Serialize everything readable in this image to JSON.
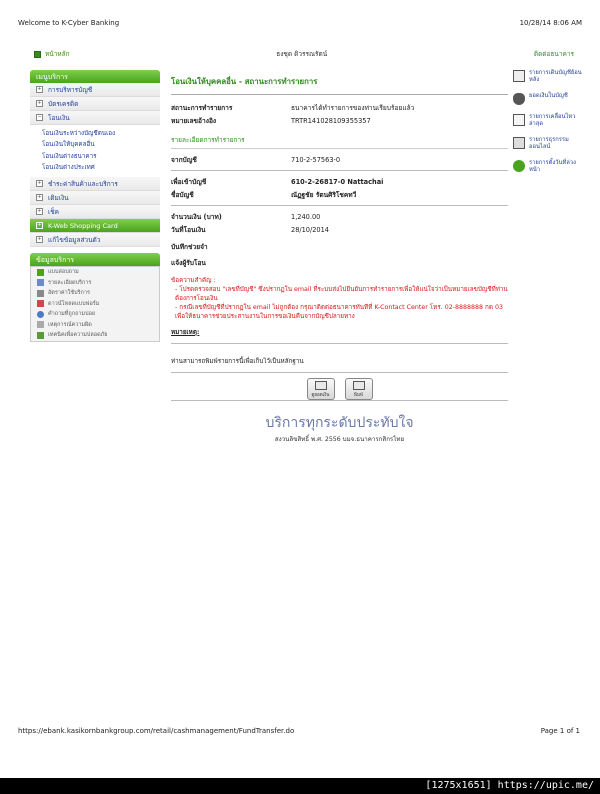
{
  "print_header": {
    "title": "Welcome to K-Cyber Banking",
    "datetime": "10/28/14 8:06 AM"
  },
  "topbar": {
    "home": "หน้าหลัก",
    "user": "ธงชุด ดิวรรณรัตน์",
    "contact": "ติดต่อธนาคาร"
  },
  "sidebar": {
    "menu_title": "เมนูบริการ",
    "items_top": [
      "การบริหารบัญชี",
      "บัตรเครดิต"
    ],
    "transfer_label": "โอนเงิน",
    "transfer_sub": [
      "โอนเงินระหว่างบัญชีตนเอง",
      "โอนเงินให้บุคคลอื่น",
      "โอนเงินต่างธนาคาร",
      "โอนเงินต่างประเทศ"
    ],
    "items_bottom": [
      "ชำระค่าสินค้าและบริการ",
      "เติมเงิน",
      "เช็ค"
    ],
    "kweb": "K-Web Shopping Card",
    "edit_info": "แก้ไขข้อมูลส่วนตัว",
    "info_title": "ข้อมูลบริการ",
    "info_items": [
      "แบบสอบถาม",
      "รายละเอียดบริการ",
      "อัตราค่าใช้บริการ",
      "ดาวน์โหลดแบบฟอร์ม",
      "คำถามที่ถูกถามบ่อย",
      "เหตุการณ์ความผิด",
      "เทคนิคเพื่อความปลอดภัย"
    ]
  },
  "main": {
    "title": "โอนเงินให้บุคคลอื่น - สถานะการทำรายการ",
    "status_label": "สถานะการทำรายการ",
    "status_value": "ธนาคารได้ทำรายการของท่านเรียบร้อยแล้ว",
    "ref_label": "หมายเลขอ้างอิง",
    "ref_value": "TRTR141028109355357",
    "section_title": "รายละเอียดการทำรายการ",
    "from_label": "จากบัญชี",
    "from_value": "710-2-57563-0",
    "to_label": "เพื่อเข้าบัญชี",
    "to_value": "610-2-26817-0 Nattachai",
    "name_label": "ชื่อบัญชี",
    "name_value": "ณัฏฐชัย รัตนศิริโชคทวี",
    "amount_label": "จำนวนเงิน (บาท)",
    "amount_value": "1,240.00",
    "date_label": "วันที่โอนเงิน",
    "date_value": "28/10/2014",
    "memo_label": "บันทึกช่วยจำ",
    "notify_label": "แจ้งผู้รับโอน",
    "notice_title": "ข้อความสำคัญ :",
    "notice_1": "- โปรดตรวจสอบ \"เลขที่บัญชี\" ซึ่งปรากฏใน email ที่ระบบส่งไปยืนยันการทำรายการเพื่อให้แน่ใจว่าเป็นหมายเลขบัญชีที่ท่านต้องการโอนเงิน",
    "notice_2": "- กรณีเลขที่บัญชีที่ปรากฏใน email ไม่ถูกต้อง กรุณาติดต่อธนาคารทันทีที่ K-Contact Center โทร. 02-8888888 กด 03 เพื่อให้ธนาคารช่วยประสานงานในการขอเงินคืนจากบัญชีปลายทาง",
    "remark_label": "หมายเหตุ:",
    "print_note": "ท่านสามารถพิมพ์รายการนี้เพื่อเก็บไว้เป็นหลักฐาน",
    "btn_preview": "ดูยอดเงิน",
    "btn_print": "พิมพ์"
  },
  "right_menu": [
    "รายการเดินบัญชีย้อนหลัง",
    "ยอดเงินในบัญชี",
    "รายการเคลื่อนไหวล่าสุด",
    "รายการธุรกรรมออนไลน์",
    "รายการตั้งวันที่ล่วงหน้า"
  ],
  "footer": {
    "slogan": "บริการทุกระดับประทับใจ",
    "copyright": "สงวนลิขสิทธิ์ พ.ศ. 2556 บมจ.ธนาคารกสิกรไทย"
  },
  "print_footer": {
    "url": "https://ebank.kasikornbankgroup.com/retail/cashmanagement/FundTransfer.do",
    "page": "Page 1 of 1"
  },
  "watermark": "[1275x1651] https://upic.me/"
}
